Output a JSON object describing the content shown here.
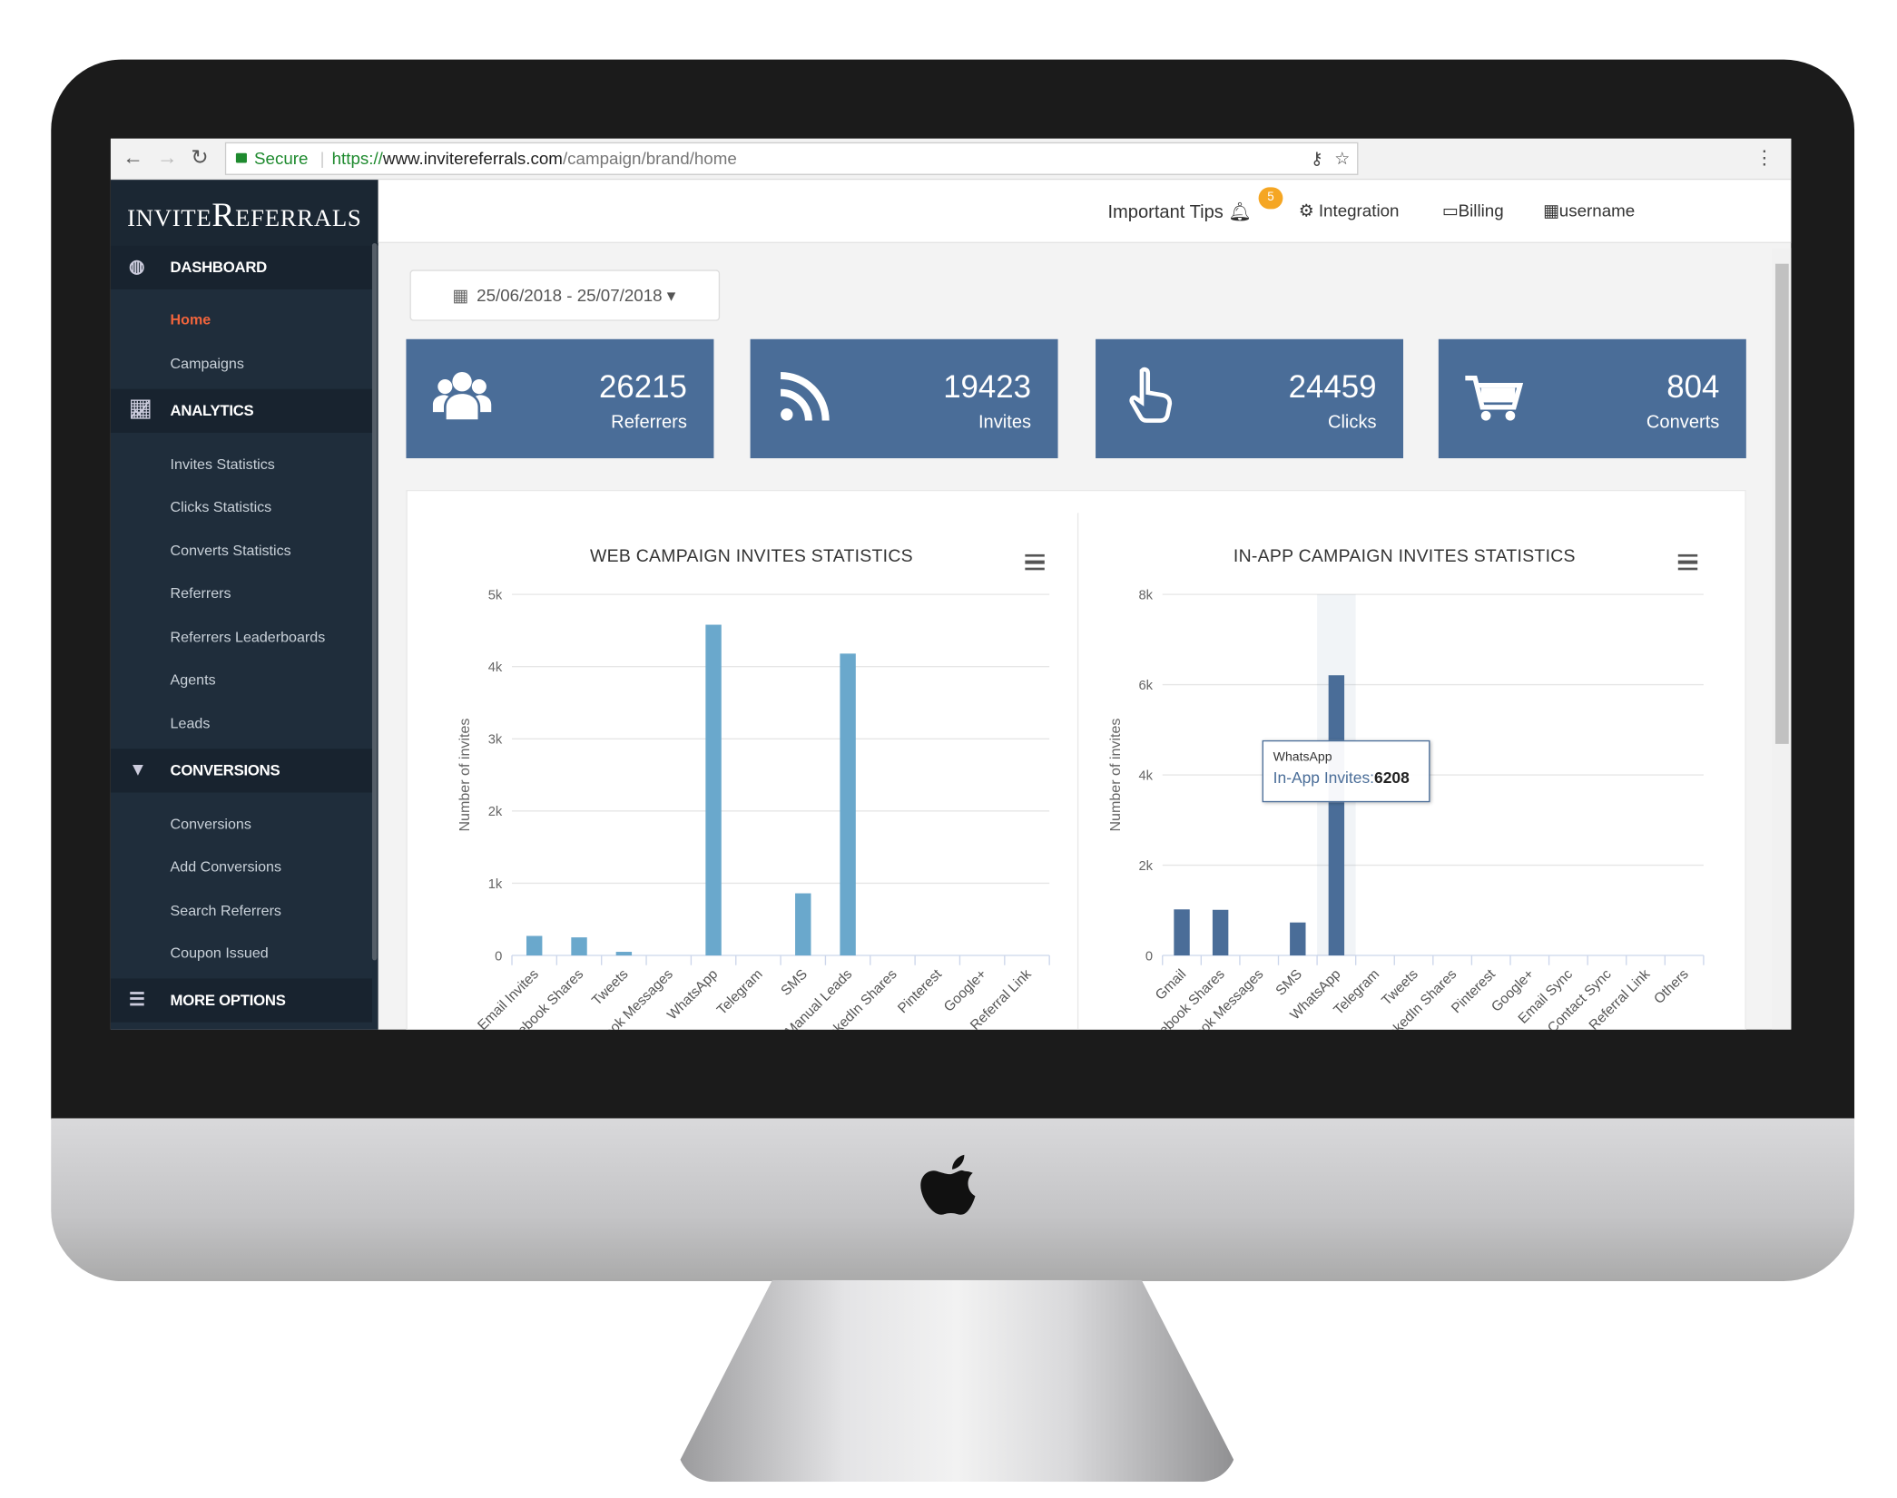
{
  "browser": {
    "secure_label": "Secure",
    "url_proto": "https://",
    "url_host": "www.invitereferrals.com",
    "url_path": "/campaign/brand/home"
  },
  "logo": "InviteReferrals",
  "sidebar": {
    "sections": [
      {
        "label": "DASHBOARD",
        "icon": "dashboard-icon",
        "items": [
          "Home",
          "Campaigns"
        ]
      },
      {
        "label": "ANALYTICS",
        "icon": "chart-line-icon",
        "items": [
          "Invites Statistics",
          "Clicks Statistics",
          "Converts Statistics",
          "Referrers",
          "Referrers Leaderboards",
          "Agents",
          "Leads"
        ]
      },
      {
        "label": "CONVERSIONS",
        "icon": "filter-icon",
        "items": [
          "Conversions",
          "Add Conversions",
          "Search Referrers",
          "Coupon Issued"
        ]
      },
      {
        "label": "MORE OPTIONS",
        "icon": "list-icon",
        "items": []
      }
    ],
    "active_item": "Home",
    "active_color": "#f0643c"
  },
  "topbar": {
    "tips": "Important Tips",
    "tips_badge": "5",
    "integration": "Integration",
    "billing": "Billing",
    "user": "username"
  },
  "date_range": "25/06/2018 - 25/07/2018",
  "stats": [
    {
      "value": "26215",
      "label": "Referrers",
      "icon": "users-icon"
    },
    {
      "value": "19423",
      "label": "Invites",
      "icon": "rss-icon"
    },
    {
      "value": "24459",
      "label": "Clicks",
      "icon": "pointer-hand-icon"
    },
    {
      "value": "804",
      "label": "Converts",
      "icon": "shopping-cart-icon"
    }
  ],
  "chart_data": [
    {
      "type": "bar",
      "title": "WEB CAMPAIGN INVITES STATISTICS",
      "ylabel": "Number of invites",
      "xlabel": "",
      "ylim": [
        0,
        5000
      ],
      "yticks": [
        "0",
        "1k",
        "2k",
        "3k",
        "4k",
        "5k"
      ],
      "grid": true,
      "color": "#6aa8cc",
      "categories": [
        "Email Invites",
        "Facebook Shares",
        "Tweets",
        "Facebook Messages",
        "WhatsApp",
        "Telegram",
        "SMS",
        "Manual Leads",
        "LinkedIn Shares",
        "Pinterest",
        "Google+",
        "Referral Link"
      ],
      "values": [
        270,
        250,
        50,
        0,
        4580,
        0,
        860,
        4180,
        0,
        0,
        0,
        0
      ]
    },
    {
      "type": "bar",
      "title": "IN-APP CAMPAIGN INVITES STATISTICS",
      "ylabel": "Number of invites",
      "xlabel": "",
      "ylim": [
        0,
        8000
      ],
      "yticks": [
        "0",
        "2k",
        "4k",
        "6k",
        "8k"
      ],
      "grid": true,
      "color": "#4a6d98",
      "categories": [
        "Gmail",
        "Facebook Shares",
        "Facebook Messages",
        "SMS",
        "WhatsApp",
        "Telegram",
        "Tweets",
        "LinkedIn Shares",
        "Pinterest",
        "Google+",
        "Email Sync",
        "Contact Sync",
        "Referral Link",
        "Others"
      ],
      "values": [
        1020,
        1010,
        0,
        730,
        6208,
        0,
        0,
        0,
        0,
        0,
        0,
        0,
        0,
        0
      ],
      "tooltip": {
        "category": "WhatsApp",
        "series": "In-App Invites",
        "value": "6208"
      }
    }
  ]
}
